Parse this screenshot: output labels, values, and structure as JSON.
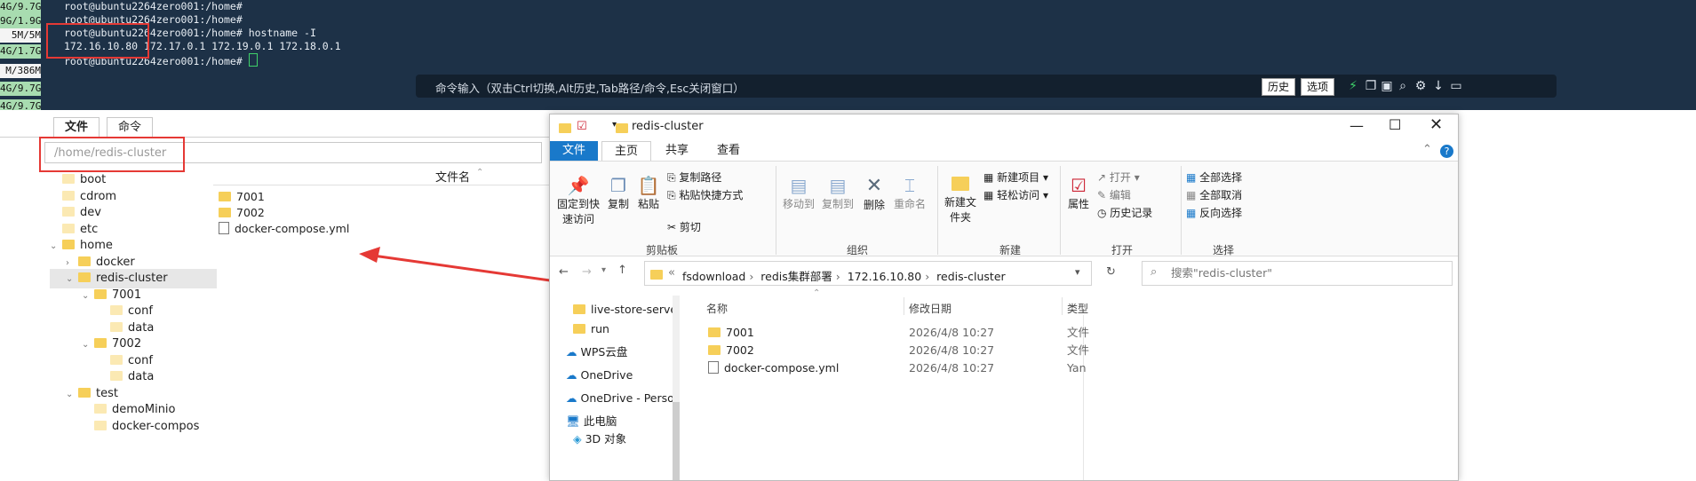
{
  "terminal": {
    "side_stats": [
      "4G/9.7G",
      "9G/1.9G",
      "5M/5M",
      "4G/1.7G",
      "M/386M",
      "4G/9.7G",
      "4G/9.7G"
    ],
    "lines": [
      "root@ubuntu2264zero001:/home#",
      "root@ubuntu2264zero001:/home#",
      "root@ubuntu2264zero001:/home# hostname -I",
      "172.16.10.80 172.17.0.1 172.19.0.1 172.18.0.1",
      "root@ubuntu2264zero001:/home#"
    ],
    "cmd_hint": "命令输入（双击Ctrl切换,Alt历史,Tab路径/命令,Esc关闭窗口）",
    "history_label": "历史",
    "options_label": "选项"
  },
  "left_pane": {
    "tabs": [
      "文件",
      "命令"
    ],
    "path": "/home/redis-cluster",
    "column_header": "文件名",
    "tree": [
      {
        "label": "boot",
        "depth": 0
      },
      {
        "label": "cdrom",
        "depth": 0
      },
      {
        "label": "dev",
        "depth": 0
      },
      {
        "label": "etc",
        "depth": 0
      },
      {
        "label": "home",
        "depth": 0,
        "expanded": true
      },
      {
        "label": "docker",
        "depth": 1
      },
      {
        "label": "redis-cluster",
        "depth": 1,
        "expanded": true,
        "selected": true
      },
      {
        "label": "7001",
        "depth": 2,
        "expanded": true
      },
      {
        "label": "conf",
        "depth": 3
      },
      {
        "label": "data",
        "depth": 3
      },
      {
        "label": "7002",
        "depth": 2,
        "expanded": true
      },
      {
        "label": "conf",
        "depth": 3
      },
      {
        "label": "data",
        "depth": 3
      },
      {
        "label": "test",
        "depth": 1,
        "expanded": true
      },
      {
        "label": "demoMinio",
        "depth": 2
      },
      {
        "label": "docker-compos",
        "depth": 2
      }
    ],
    "files": [
      {
        "name": "7001",
        "type": "folder"
      },
      {
        "name": "7002",
        "type": "folder"
      },
      {
        "name": "docker-compose.yml",
        "type": "file"
      }
    ]
  },
  "explorer": {
    "title": "redis-cluster",
    "ribbon_tabs": [
      "文件",
      "主页",
      "共享",
      "查看"
    ],
    "clipboard": {
      "pin": "固定到快速访问",
      "copy": "复制",
      "paste": "粘贴",
      "copy_path": "复制路径",
      "paste_shortcut": "粘贴快捷方式",
      "cut": "剪切",
      "label": "剪贴板"
    },
    "organize": {
      "move_to": "移动到",
      "copy_to": "复制到",
      "delete": "删除",
      "rename": "重命名",
      "label": "组织"
    },
    "new": {
      "new_folder": "新建文件夹",
      "new_item": "新建项目",
      "easy_access": "轻松访问",
      "label": "新建"
    },
    "open": {
      "properties": "属性",
      "open": "打开",
      "edit": "编辑",
      "history": "历史记录",
      "label": "打开"
    },
    "select": {
      "select_all": "全部选择",
      "select_none": "全部取消",
      "invert": "反向选择",
      "label": "选择"
    },
    "breadcrumb": [
      "fsdownload",
      "redis集群部署",
      "172.16.10.80",
      "redis-cluster"
    ],
    "search_placeholder": "搜索\"redis-cluster\"",
    "nav": [
      "live-store-serve",
      "run",
      "WPS云盘",
      "OneDrive",
      "OneDrive - Perso",
      "此电脑",
      "3D 对象"
    ],
    "columns": [
      "名称",
      "修改日期",
      "类型"
    ],
    "files": [
      {
        "name": "7001",
        "date": "2026/4/8 10:27",
        "type": "文件"
      },
      {
        "name": "7002",
        "date": "2026/4/8 10:27",
        "type": "文件"
      },
      {
        "name": "docker-compose.yml",
        "date": "2026/4/8 10:27",
        "type": "Yan"
      }
    ]
  },
  "colors": {
    "terminal_bg": "#1d3147",
    "annotation_red": "#e53935",
    "ribbon_blue": "#1979ca",
    "folder_yellow": "#f6cf59"
  }
}
